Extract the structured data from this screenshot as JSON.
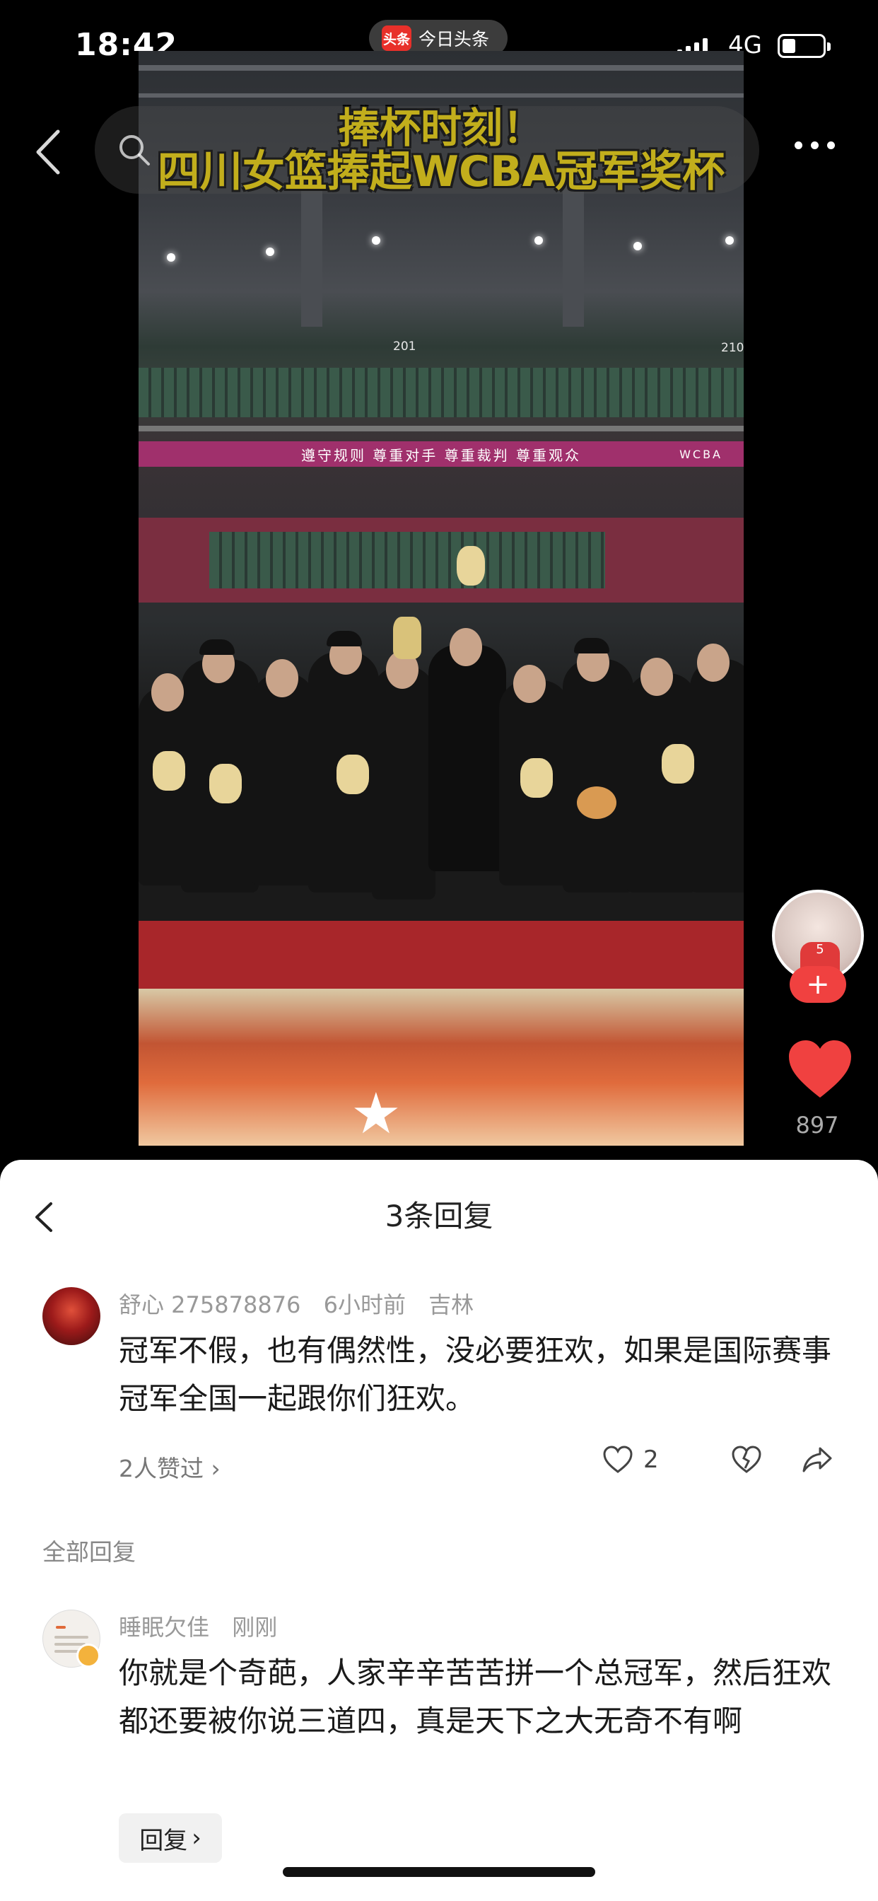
{
  "status": {
    "time": "18:42",
    "app_name": "今日头条",
    "app_logo": "头条",
    "network": "4G"
  },
  "video": {
    "overlay_line1": "捧杯时刻！",
    "overlay_line2": "四川女篮捧起WCBA冠军奖杯",
    "section_left": "201",
    "section_right": "210",
    "banner_text": "遵守规则 尊重对手 尊重裁判 尊重观众",
    "banner_logo": "WCBA"
  },
  "side": {
    "like_count": "897",
    "follow_symbol": "+",
    "jersey_text": "5"
  },
  "sheet": {
    "title": "3条回复",
    "comment": {
      "user": "舒心 275878876",
      "time": "6小时前",
      "location": "吉林",
      "text": "冠军不假，也有偶然性，没必要狂欢，如果是国际赛事冠军全国一起跟你们狂欢。",
      "likers": "2人赞过",
      "like_count": "2"
    },
    "all_replies_label": "全部回复",
    "reply": {
      "user": "睡眠欠佳",
      "time": "刚刚",
      "text": "你就是个奇葩，人家辛辛苦苦拼一个总冠军，然后狂欢都还要被你说三道四，真是天下之大无奇不有啊",
      "reply_button": "回复"
    }
  },
  "colors": {
    "accent_red": "#f04140",
    "title_yellow": "#ffe000",
    "banner_magenta": "#a0306c"
  }
}
